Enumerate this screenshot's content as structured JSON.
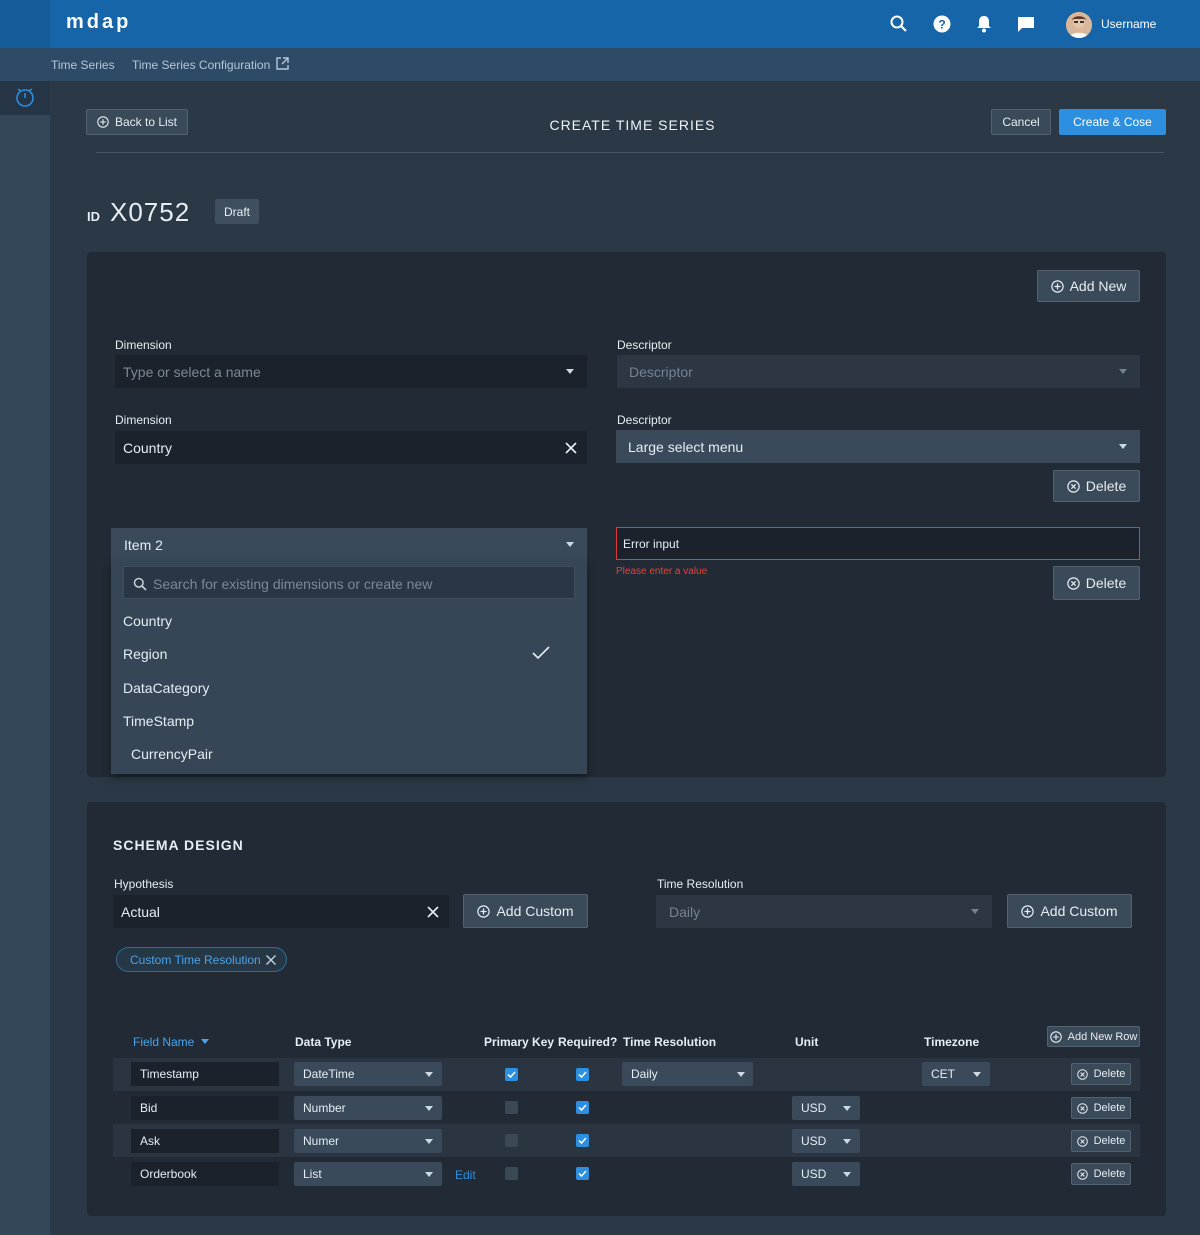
{
  "app": {
    "brand": "mdap",
    "username": "Username"
  },
  "subnav": {
    "item1": "Time Series",
    "item2": "Time Series Configuration"
  },
  "toolbar": {
    "back": "Back to List",
    "title": "CREATE TIME SERIES",
    "cancel": "Cancel",
    "create": "Create & Cose"
  },
  "record": {
    "id_label": "ID",
    "id_value": "X0752",
    "status": "Draft"
  },
  "dimensions": {
    "add_new": "Add New",
    "row1": {
      "dim_label": "Dimension",
      "dim_placeholder": "Type or select a name",
      "desc_label": "Descriptor",
      "desc_placeholder": "Descriptor"
    },
    "row2": {
      "dim_label": "Dimension",
      "dim_value": "Country",
      "desc_label": "Descriptor",
      "desc_value": "Large select menu",
      "delete": "Delete"
    },
    "row3": {
      "dim_value": "Item 2",
      "error_input": "Error input",
      "error_text": "Please enter a value",
      "delete": "Delete"
    },
    "dropdown": {
      "search_placeholder": "Search for existing dimensions or create new",
      "options": [
        "Country",
        "Region",
        "DataCategory",
        "TimeStamp",
        "CurrencyPair"
      ],
      "selected": "Region"
    }
  },
  "schema": {
    "title": "SCHEMA DESIGN",
    "hypothesis_label": "Hypothesis",
    "hypothesis_value": "Actual",
    "add_custom_1": "Add Custom",
    "time_res_label": "Time Resolution",
    "time_res_value": "Daily",
    "add_custom_2": "Add Custom",
    "tag": "Custom Time Resolution",
    "add_row": "Add New Row",
    "headers": {
      "field": "Field Name",
      "type": "Data Type",
      "pk": "Primary Key",
      "req": "Required?",
      "res": "Time Resolution",
      "unit": "Unit",
      "tz": "Timezone"
    },
    "rows": [
      {
        "field": "Timestamp",
        "type": "DateTime",
        "pk": true,
        "req": true,
        "res": "Daily",
        "unit": "",
        "tz": "CET",
        "delete": "Delete"
      },
      {
        "field": "Bid",
        "type": "Number",
        "pk": false,
        "req": true,
        "res": "",
        "unit": "USD",
        "tz": "",
        "delete": "Delete"
      },
      {
        "field": "Ask",
        "type": "Numer",
        "pk": false,
        "req": true,
        "res": "",
        "unit": "USD",
        "tz": "",
        "delete": "Delete"
      },
      {
        "field": "Orderbook",
        "type": "List",
        "edit": "Edit",
        "pk": false,
        "req": true,
        "res": "",
        "unit": "USD",
        "tz": "",
        "delete": "Delete"
      }
    ]
  }
}
